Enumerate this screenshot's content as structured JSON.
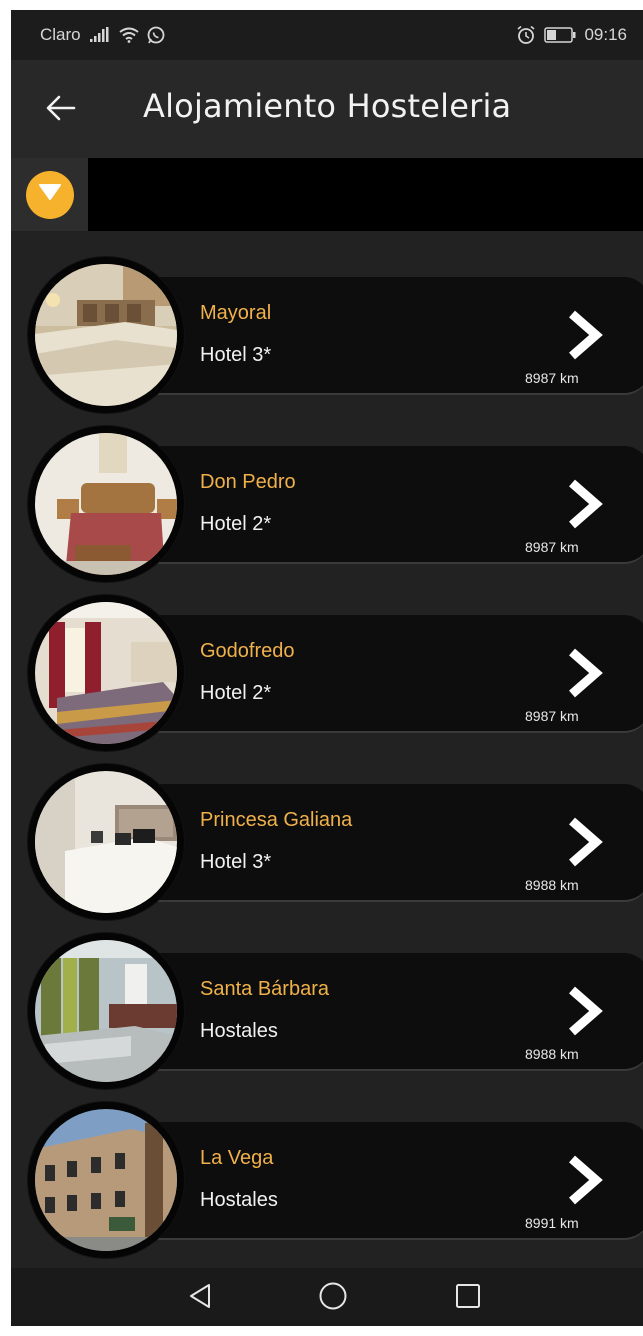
{
  "status_bar": {
    "carrier": "Claro",
    "time": "09:16",
    "icons": [
      "signal-icon",
      "wifi-icon",
      "whatsapp-icon",
      "alarm-icon",
      "battery-icon"
    ]
  },
  "app_bar": {
    "title": "Alojamiento Hosteleria",
    "back_icon": "arrow-left-icon"
  },
  "filter": {
    "toggle_icon": "triangle-down-icon",
    "accent_color": "#f6b22c"
  },
  "listings": [
    {
      "name": "Mayoral",
      "category": "Hotel 3*",
      "distance": "8987 km"
    },
    {
      "name": "Don Pedro",
      "category": "Hotel 2*",
      "distance": "8987 km"
    },
    {
      "name": "Godofredo",
      "category": "Hotel 2*",
      "distance": "8987 km"
    },
    {
      "name": "Princesa Galiana",
      "category": "Hotel 3*",
      "distance": "8988 km"
    },
    {
      "name": "Santa Bárbara",
      "category": "Hostales",
      "distance": "8988 km"
    },
    {
      "name": "La Vega",
      "category": "Hostales",
      "distance": "8991 km"
    }
  ],
  "nav_bar": {
    "icons": [
      "nav-back-icon",
      "nav-home-icon",
      "nav-recents-icon"
    ]
  },
  "colors": {
    "name_text": "#f0b14b",
    "card_bg": "#0d0d0d",
    "screen_bg": "#222222"
  }
}
